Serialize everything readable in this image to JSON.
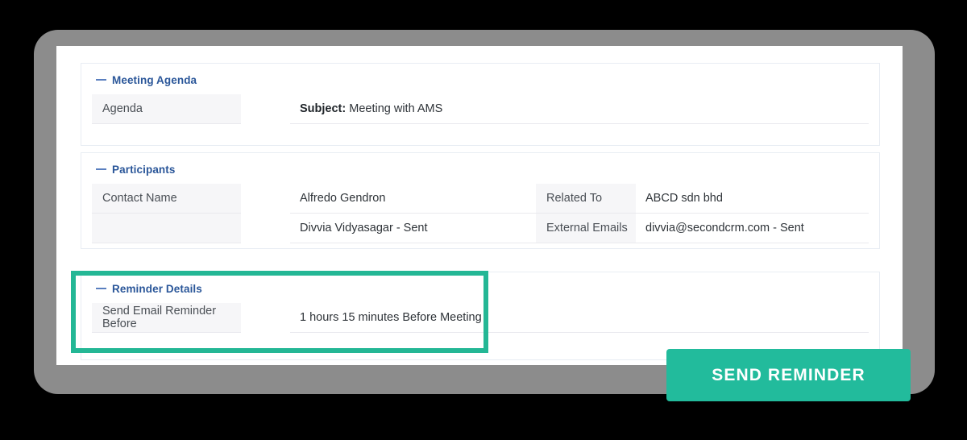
{
  "window": {
    "background_color": "#000000",
    "bezel_color": "#8c8c8c",
    "card_color": "#ffffff",
    "accent_color": "#22bb9c",
    "heading_color": "#2a5699"
  },
  "panels": [
    {
      "id": "meeting-agenda",
      "title": "Meeting Agenda",
      "collapse_icon": "minus-icon",
      "rows": [
        {
          "label": "Agenda",
          "value_prefix": "Subject:",
          "value": "Meeting with AMS"
        }
      ]
    },
    {
      "id": "participants",
      "title": "Participants",
      "collapse_icon": "minus-icon",
      "rows": [
        {
          "label": "Contact Name",
          "value": "Alfredo Gendron",
          "label2": "Related To",
          "value2": "ABCD sdn bhd"
        },
        {
          "label": "",
          "value": "Divvia Vidyasagar - Sent",
          "label2": "External Emails",
          "value2": "divvia@secondcrm.com - Sent"
        }
      ]
    },
    {
      "id": "reminder-details",
      "title": "Reminder Details",
      "collapse_icon": "minus-icon",
      "highlighted": true,
      "rows": [
        {
          "label": "Send Email Reminder Before",
          "value": "1 hours 15 minutes Before Meeting"
        }
      ]
    }
  ],
  "actions": {
    "send_reminder_label": "Send Reminder"
  }
}
